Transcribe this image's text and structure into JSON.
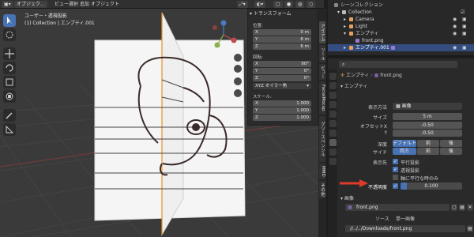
{
  "header": {
    "mode": "オブジェク...",
    "menu": [
      "ビュー",
      "選択",
      "追加",
      "オブジェクト"
    ]
  },
  "viewport": {
    "title": "ユーザー・透視投影",
    "subtitle": "(1) Collection | エンプティ.001"
  },
  "npanel": {
    "section": "トランスフォーム",
    "location_label": "位置:",
    "location": [
      {
        "axis": "X",
        "value": "0 m"
      },
      {
        "axis": "Y",
        "value": "6 m"
      },
      {
        "axis": "Z",
        "value": "6 m"
      }
    ],
    "rotation_label": "回転:",
    "rotation": [
      {
        "axis": "X",
        "value": "90°"
      },
      {
        "axis": "Y",
        "value": "0°"
      },
      {
        "axis": "Z",
        "value": "0°"
      }
    ],
    "euler": "XYZ オイラー角",
    "scale_label": "スケール:",
    "scale": [
      {
        "axis": "X",
        "value": "1.000"
      },
      {
        "axis": "Y",
        "value": "1.000"
      },
      {
        "axis": "Z",
        "value": "1.000"
      }
    ]
  },
  "vtabs": [
    "アイテム",
    "ツール",
    "ビュー",
    "FacialMocap",
    "グリースペンシル",
    "MMD",
    "その他"
  ],
  "outliner": {
    "title": "シーンコレクション",
    "rows": [
      {
        "label": "Collection",
        "color": "#d8d8d8"
      },
      {
        "label": "Camera",
        "color": "#e8a060"
      },
      {
        "label": "Light",
        "color": "#e8a060"
      },
      {
        "label": "エンプティ",
        "color": "#e8a060"
      },
      {
        "label": "front.png",
        "color": "#d8d8d8"
      },
      {
        "label": "エンプティ.001",
        "color": "#ffffff"
      }
    ]
  },
  "props": {
    "breadcrumb_obj": "エンプティ",
    "breadcrumb_img": "front.png",
    "panel": "エンプティ",
    "display_label": "表示方法",
    "display_value": "画像",
    "size_label": "サイズ",
    "size_value": "5 m",
    "offset_x_label": "オフセットX",
    "offset_x_value": "-0.50",
    "offset_y_label": "Y",
    "offset_y_value": "-0.50",
    "depth_label": "深度",
    "depth_options": [
      "デフォルト",
      "前",
      "後"
    ],
    "side_label": "サイド",
    "side_options": [
      "両方",
      "前",
      "後"
    ],
    "show_label": "表示先",
    "show_options": [
      "平行投影",
      "透視投影",
      "軸に平行な時のみ"
    ],
    "opacity_label": "不透明度",
    "opacity_value": "0.100",
    "image_section": "画像",
    "image_name": "front.png",
    "source_label": "ソース",
    "source_value": "単一画像",
    "path_value": "//../../Downloads/front.png"
  }
}
